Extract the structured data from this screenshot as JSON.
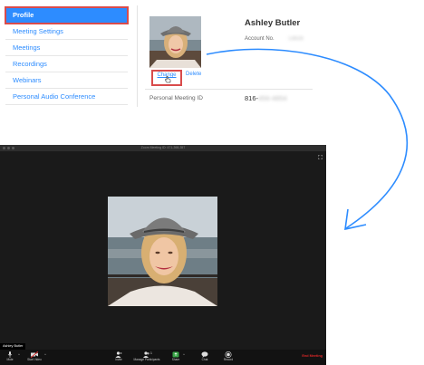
{
  "sidebar": {
    "items": [
      {
        "label": "Profile",
        "active": true
      },
      {
        "label": "Meeting Settings"
      },
      {
        "label": "Meetings"
      },
      {
        "label": "Recordings"
      },
      {
        "label": "Webinars"
      },
      {
        "label": "Personal Audio Conference"
      }
    ]
  },
  "profile": {
    "name": "Ashley Butler",
    "account_label": "Account No.",
    "account_value": "13828",
    "change_label": "Change",
    "delete_label": "Delete",
    "pmi_label": "Personal Meeting ID",
    "pmi_prefix": "816-",
    "pmi_blurred": "456-4854"
  },
  "meeting": {
    "window_title": "Zoom Meeting ID: 471-398-357",
    "participant_name": "Ashley Butler",
    "toolbar": {
      "mute": "Mute",
      "start_video": "Start Video",
      "invite": "Invite",
      "manage_participants": "Manage Participants",
      "participants_count": "1",
      "share": "Share",
      "chat": "Chat",
      "record": "Record",
      "end_meeting": "End Meeting"
    }
  },
  "colors": {
    "accent": "#2d8cff",
    "highlight_box": "#d94b4b",
    "annotation_arrow": "#2d8cff",
    "end_meeting": "#e02828"
  }
}
